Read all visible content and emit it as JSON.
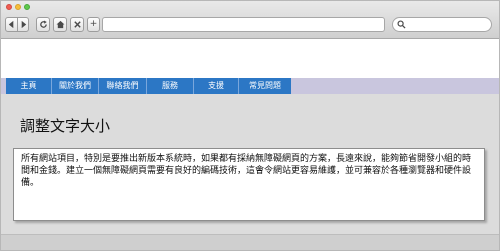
{
  "browser": {
    "url": "",
    "search_placeholder": "",
    "new_tab_label": "+"
  },
  "nav": {
    "items": [
      {
        "label": "主頁"
      },
      {
        "label": "關於我們"
      },
      {
        "label": "聯絡我們"
      },
      {
        "label": "服務"
      },
      {
        "label": "支援"
      },
      {
        "label": "常見問題"
      }
    ],
    "bar_color": "#2c77c5",
    "strip_color": "#c9c6de"
  },
  "main": {
    "heading": "調整文字大小",
    "body": "所有網站項目，特別是要推出新版本系統時，如果都有採納無障礙網頁的方案，長遠來說，能夠節省開發小組的時間和金錢。建立一個無障礙網頁需要有良好的編碼技術，這會令網站更容易維護，並可兼容於各種瀏覽器和硬件設備。"
  }
}
